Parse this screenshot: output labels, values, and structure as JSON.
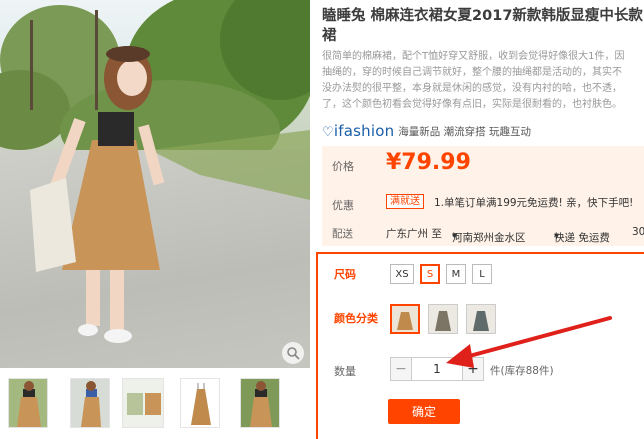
{
  "product": {
    "title_line1": "瞌睡兔 棉麻连衣裙女夏2017新款韩版显瘦中长款",
    "title_line2": "裙",
    "description": [
      "很简单的棉麻裙，配个T恤好穿又舒服，收到会觉得好像很大1件，因",
      "抽绳的，穿的时候自己调节就好，整个腰的抽绳都是活动的，其实不",
      "没办法熨的很平整，本身就是休闲的感觉，没有内衬的哈，也不透，",
      "了，这个颜色初看会觉得好像有点旧，实际是很耐看的，也衬肤色。"
    ]
  },
  "brand": {
    "logo_text": "ifashion",
    "tags": "海量新品 潮流穿搭 玩趣互动"
  },
  "price_section": {
    "price_label": "价格",
    "price_value": "¥79.99",
    "promo_label": "优惠",
    "promo_badge": "满就送",
    "promo_text": "1.单笔订单满199元免运费! 亲，快下手吧!",
    "ship_label": "配送",
    "ship_from": "广东广州 至",
    "ship_to": "河南郑州金水区",
    "ship_method": "快递 免运费",
    "ship_extra": "30"
  },
  "options": {
    "size_label": "尺码",
    "sizes": [
      "XS",
      "S",
      "M",
      "L"
    ],
    "selected_size": "S",
    "color_label": "颜色分类",
    "quantity_label": "数量",
    "quantity_minus": "−",
    "quantity_value": "1",
    "quantity_plus": "+",
    "stock_text": "件(库存88件)",
    "confirm_label": "确定"
  },
  "colors": {
    "accent": "#ff4400",
    "price_bg": "#fff2e8",
    "brand_blue": "#1a5ea8"
  },
  "icons": {
    "zoom": "magnifier-icon",
    "annotation": "red-arrow"
  }
}
